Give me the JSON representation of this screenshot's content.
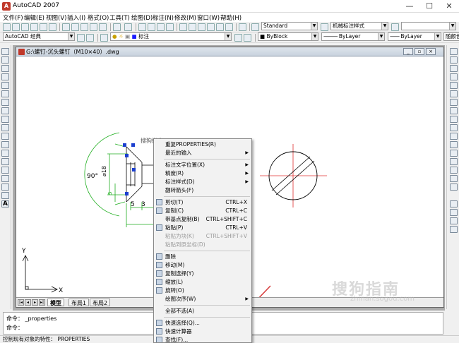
{
  "app": {
    "title": "AutoCAD 2007",
    "icon": "autocad-logo-icon"
  },
  "window_controls": [
    "—",
    "☐",
    "✕"
  ],
  "menu": [
    "文件(F)",
    "编辑(E)",
    "视图(V)",
    "插入(I)",
    "格式(O)",
    "工具(T)",
    "绘图(D)",
    "标注(N)",
    "修改(M)",
    "窗口(W)",
    "帮助(H)"
  ],
  "toolbar": {
    "text_style": "Standard",
    "dim_style": "机械标注样式",
    "workspace": "AutoCAD 经典",
    "layer": "标注",
    "color": "ByBlock",
    "linetype": "ByLayer",
    "lineweight": "ByLayer",
    "plotstyle": "随颜色"
  },
  "document": {
    "title": "G:\\螺钉-沉头螺钉（M10×40）.dwg",
    "tabs": [
      "模型",
      "布局1",
      "布局2"
    ]
  },
  "drawing": {
    "angle": "90°",
    "diameter": "⌀18",
    "dim_5": "5",
    "dim_3": "3",
    "small_5": "5",
    "tooltip": "搜狗指南",
    "ucs_x": "X",
    "ucs_y": "Y"
  },
  "context_menu": {
    "items": [
      {
        "label": "重复PROPERTIES(R)",
        "sc": "",
        "sub": false,
        "dis": false,
        "icon": ""
      },
      {
        "label": "最近的输入",
        "sc": "",
        "sub": true,
        "dis": false,
        "icon": ""
      },
      {
        "sep": true
      },
      {
        "label": "标注文字位置(X)",
        "sc": "",
        "sub": true,
        "dis": false,
        "icon": ""
      },
      {
        "label": "精度(R)",
        "sc": "",
        "sub": true,
        "dis": false,
        "icon": ""
      },
      {
        "label": "标注样式(D)",
        "sc": "",
        "sub": true,
        "dis": false,
        "icon": ""
      },
      {
        "label": "翻转箭头(F)",
        "sc": "",
        "sub": false,
        "dis": false,
        "icon": ""
      },
      {
        "sep": true
      },
      {
        "label": "剪切(T)",
        "sc": "CTRL+X",
        "sub": false,
        "dis": false,
        "icon": "scissors-icon"
      },
      {
        "label": "复制(C)",
        "sc": "CTRL+C",
        "sub": false,
        "dis": false,
        "icon": "copy-icon"
      },
      {
        "label": "带基点复制(B)",
        "sc": "CTRL+SHIFT+C",
        "sub": false,
        "dis": false,
        "icon": ""
      },
      {
        "label": "粘贴(P)",
        "sc": "CTRL+V",
        "sub": false,
        "dis": false,
        "icon": "paste-icon"
      },
      {
        "label": "粘贴为块(K)",
        "sc": "CTRL+SHIFT+V",
        "sub": false,
        "dis": true,
        "icon": ""
      },
      {
        "label": "粘贴到原坐标(D)",
        "sc": "",
        "sub": false,
        "dis": true,
        "icon": ""
      },
      {
        "sep": true
      },
      {
        "label": "删除",
        "sc": "",
        "sub": false,
        "dis": false,
        "icon": "eraser-icon"
      },
      {
        "label": "移动(M)",
        "sc": "",
        "sub": false,
        "dis": false,
        "icon": "move-icon"
      },
      {
        "label": "复制选择(Y)",
        "sc": "",
        "sub": false,
        "dis": false,
        "icon": "copy-select-icon"
      },
      {
        "label": "缩放(L)",
        "sc": "",
        "sub": false,
        "dis": false,
        "icon": "scale-icon"
      },
      {
        "label": "旋转(O)",
        "sc": "",
        "sub": false,
        "dis": false,
        "icon": "rotate-icon"
      },
      {
        "label": "绘图次序(W)",
        "sc": "",
        "sub": true,
        "dis": false,
        "icon": ""
      },
      {
        "sep": true
      },
      {
        "label": "全部不选(A)",
        "sc": "",
        "sub": false,
        "dis": false,
        "icon": ""
      },
      {
        "sep": true
      },
      {
        "label": "快速选择(Q)...",
        "sc": "",
        "sub": false,
        "dis": false,
        "icon": "quick-select-icon"
      },
      {
        "label": "快速计算器",
        "sc": "",
        "sub": false,
        "dis": false,
        "icon": "calculator-icon"
      },
      {
        "label": "查找(F)...",
        "sc": "",
        "sub": false,
        "dis": false,
        "icon": "find-icon"
      },
      {
        "label": "特性(S)",
        "sc": "",
        "sub": false,
        "dis": false,
        "icon": "properties-icon",
        "hl": true
      }
    ]
  },
  "command": {
    "line1": "命令： _properties",
    "line2": "命令："
  },
  "status": {
    "text": "控制现有对象的特性：  PROPERTIES"
  },
  "watermark": {
    "text": "搜狗指南",
    "sub": "zhinan.sogou.com"
  },
  "colors": {
    "highlight": "#0a64c8",
    "dimension": "#1fae1f",
    "redline": "#e03030",
    "grip": "#1b3fcf",
    "arrow": "#d63a3a"
  }
}
